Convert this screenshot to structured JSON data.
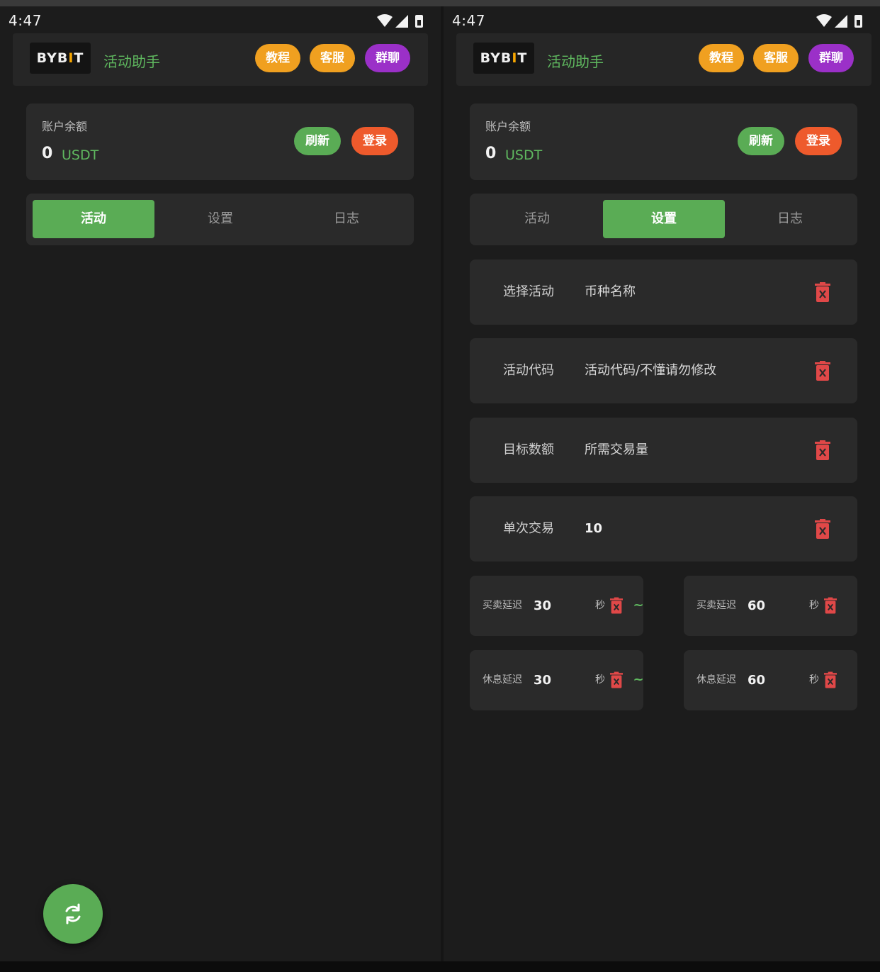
{
  "status_bar": {
    "time": "4:47"
  },
  "header": {
    "logo_text": "BYB",
    "logo_bar": "I",
    "logo_end": "T",
    "app_title": "活动助手",
    "buttons": {
      "tutorial": "教程",
      "support": "客服",
      "group": "群聊"
    }
  },
  "balance": {
    "label": "账户余额",
    "value": "0",
    "unit": "USDT",
    "refresh_label": "刷新",
    "login_label": "登录"
  },
  "tabs": [
    {
      "label": "活动"
    },
    {
      "label": "设置"
    },
    {
      "label": "日志"
    }
  ],
  "active_tab": {
    "left_screen": "活动",
    "right_screen": "设置"
  },
  "settings": {
    "rows": [
      {
        "label": "选择活动",
        "value": "币种名称"
      },
      {
        "label": "活动代码",
        "value": "活动代码/不懂请勿修改"
      },
      {
        "label": "目标数额",
        "value": "所需交易量"
      },
      {
        "label": "单次交易",
        "value": "10"
      }
    ],
    "trade_delay": {
      "label": "买卖延迟",
      "min": "30",
      "max": "60",
      "unit": "秒"
    },
    "rest_delay": {
      "label": "休息延迟",
      "min": "30",
      "max": "60",
      "unit": "秒"
    },
    "range_separator": "~"
  },
  "fab": {
    "icon": "refresh-icon"
  },
  "colors": {
    "background": "#1c1c1c",
    "card": "#2a2a2a",
    "accent_green": "#5aac55",
    "orange": "#f0a020",
    "purple": "#9b30c8",
    "red": "#ee5a2c",
    "trash_red": "#e04848"
  }
}
